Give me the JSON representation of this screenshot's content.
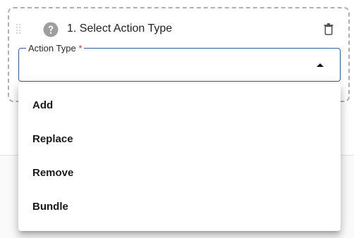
{
  "step": {
    "title": "1. Select Action Type",
    "icons": {
      "drag": "drag-handle-icon",
      "help": "help-circle-icon",
      "delete": "trash-icon"
    }
  },
  "action_type_field": {
    "label": "Action Type",
    "required_marker": "*",
    "value": "",
    "state": "open"
  },
  "dropdown": {
    "options": [
      {
        "label": "Add"
      },
      {
        "label": "Replace"
      },
      {
        "label": "Remove"
      },
      {
        "label": "Bundle"
      }
    ]
  },
  "colors": {
    "field_border": "#2f5ea8",
    "required": "#d32f2f",
    "help_icon": "#9e9e9e",
    "card_border": "#b0b0b0"
  }
}
